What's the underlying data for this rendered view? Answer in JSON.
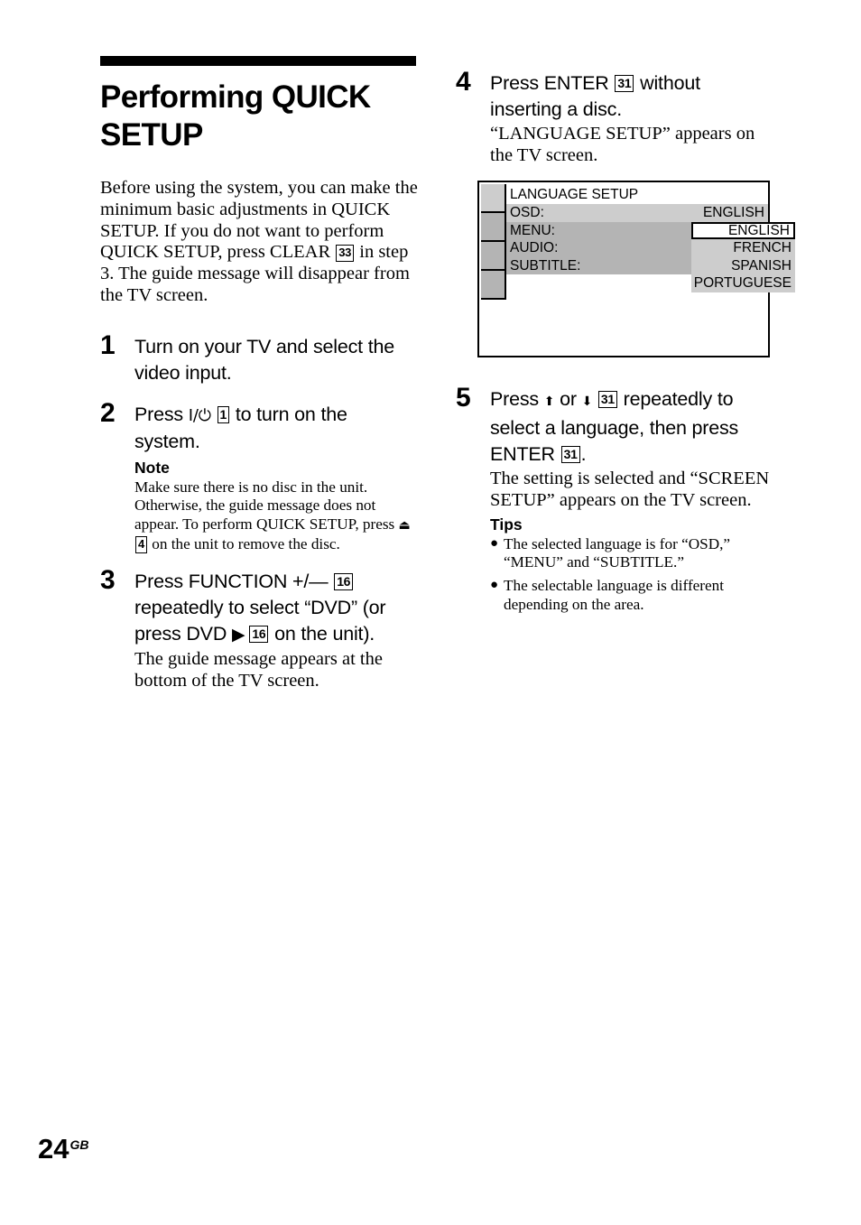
{
  "document": {
    "page_number": "24",
    "page_suffix": "GB"
  },
  "left_column": {
    "title": "Performing QUICK SETUP",
    "intro_parts": {
      "before_ref": "Before using the system, you can make the minimum basic adjustments in QUICK SETUP. If you do not want to perform QUICK SETUP, press CLEAR",
      "ref": "33",
      "after_ref": "in step 3. The guide message will disappear from the TV screen."
    },
    "steps": [
      {
        "number": "1",
        "head_text": "Turn on your TV and select the video input."
      },
      {
        "number": "2",
        "head_before": "Press",
        "head_power_glyph": "I/⏻",
        "head_ref": "1",
        "head_after": "to turn on the system.",
        "note_label": "Note",
        "note_before": "Make sure there is no disc in the unit. Otherwise, the guide message does not appear. To perform QUICK SETUP, press",
        "note_glyph": "⏏",
        "note_ref": "4",
        "note_after": "on the unit to remove the disc."
      },
      {
        "number": "3",
        "head_before": "Press FUNCTION +/—",
        "head_ref_1": "16",
        "head_middle": "repeatedly to select “DVD” (or press DVD",
        "head_play_glyph": "▶",
        "head_ref_2": "16",
        "head_after": "on the unit).",
        "body": "The guide message appears at the bottom of the TV screen."
      }
    ]
  },
  "right_column": {
    "steps": [
      {
        "number": "4",
        "head_before": "Press ENTER",
        "head_ref": "31",
        "head_after": "without inserting a disc.",
        "body": "“LANGUAGE SETUP” appears on the TV screen."
      },
      {
        "number": "5",
        "head_before": "Press",
        "head_up_glyph": "⬆",
        "head_or": "or",
        "head_down_glyph": "⬇",
        "head_ref_1": "31",
        "head_middle": "repeatedly to select a language, then press ENTER",
        "head_ref_2": "31",
        "head_after": ".",
        "body": "The setting is selected and “SCREEN SETUP” appears on the TV screen.",
        "tips_label": "Tips",
        "tips": [
          "The selected language is for “OSD,” “MENU” and “SUBTITLE.”",
          "The selectable language is different depending on the area."
        ]
      }
    ]
  },
  "osd_screen": {
    "title": "LANGUAGE SETUP",
    "rows": [
      {
        "label": "OSD:",
        "value": "ENGLISH"
      },
      {
        "label": "MENU:",
        "value": ""
      },
      {
        "label": "AUDIO:",
        "value": ""
      },
      {
        "label": "SUBTITLE:",
        "value": ""
      }
    ],
    "dropdown_options": [
      "ENGLISH",
      "FRENCH",
      "SPANISH",
      "PORTUGUESE"
    ],
    "selected_option": "ENGLISH",
    "tab_count": 4,
    "colors": {
      "light_gray": "#cdcdcd",
      "dark_gray": "#b4b4b4",
      "border": "#000000"
    }
  }
}
